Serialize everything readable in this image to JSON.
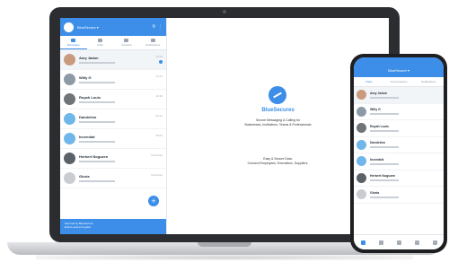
{
  "app": {
    "brand_name": "BlueSecures",
    "tagline_lines": [
      "Secure Messaging & Calling for",
      "Businesses, Institutions, Teams & Professionals"
    ],
    "tagline2_lines": [
      "Easy & Secure Data.",
      "Connect Employees, Executives, Suppliers."
    ],
    "accent_color": "#3c8ee8"
  },
  "laptop": {
    "header_title": "BlueSecure ▾",
    "tabs": [
      {
        "label": "Messages",
        "icon": "chat-icon"
      },
      {
        "label": "Calls",
        "icon": "phone-icon"
      },
      {
        "label": "Contacts",
        "icon": "contacts-icon"
      },
      {
        "label": "Notifications",
        "icon": "bell-icon"
      }
    ],
    "chats": [
      {
        "name": "Amy Jadun",
        "time": "12:44"
      },
      {
        "name": "Willy G",
        "time": "11:03"
      },
      {
        "name": "Royah Louis",
        "time": "10:20"
      },
      {
        "name": "Dandeiion",
        "time": "09:12"
      },
      {
        "name": "Incendiat",
        "time": "08:54"
      },
      {
        "name": "Herbert Noguzen",
        "time": "Yesterday"
      },
      {
        "name": "Gloria",
        "time": "Yesterday"
      }
    ],
    "footer_line1": "Secured by BlueSecure",
    "footer_line2": "End-to-end encrypted"
  },
  "phone": {
    "header_title": "BlueSecure ▾",
    "tabs": [
      "Chats",
      "Conversations",
      "Notifications"
    ],
    "chats": [
      {
        "name": "Amy Jadun"
      },
      {
        "name": "Willy G"
      },
      {
        "name": "Royah Louis"
      },
      {
        "name": "Dandeiion"
      },
      {
        "name": "Incendiat"
      },
      {
        "name": "Herbert Noguzen"
      },
      {
        "name": "Gloria"
      }
    ],
    "nav_icons": [
      "chat-icon",
      "phone-icon",
      "contacts-icon",
      "bell-icon",
      "more-icon"
    ]
  }
}
